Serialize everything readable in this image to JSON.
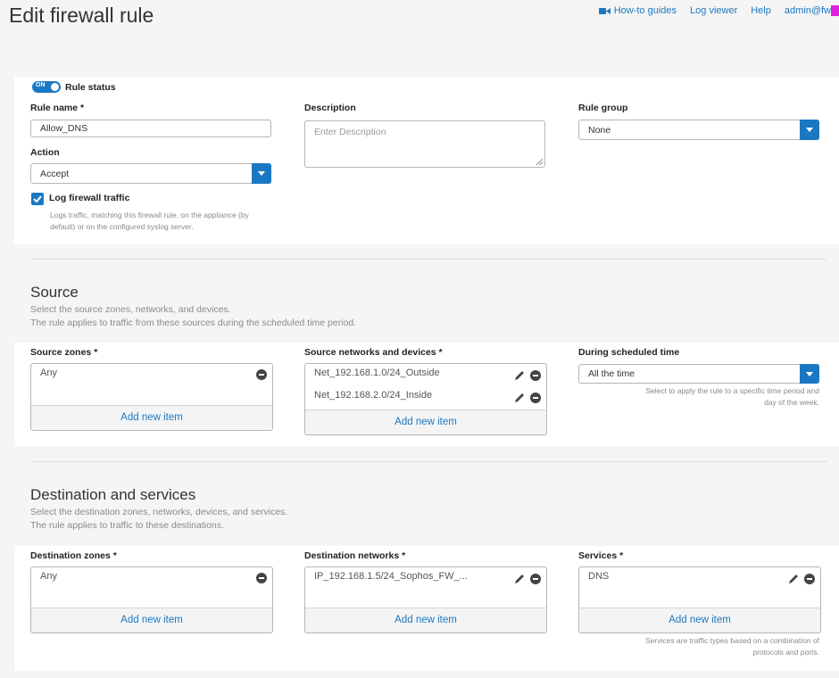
{
  "header": {
    "title": "Edit firewall rule",
    "nav": {
      "howto": "How-to guides",
      "logviewer": "Log viewer",
      "help": "Help",
      "admin": "admin@fw"
    }
  },
  "rule": {
    "status_toggle": "ON",
    "status_label": "Rule status",
    "name_label": "Rule name *",
    "name_value": "Allow_DNS",
    "description_label": "Description",
    "description_placeholder": "Enter Description",
    "group_label": "Rule group",
    "group_value": "None",
    "action_label": "Action",
    "action_value": "Accept",
    "log_label": "Log firewall traffic",
    "log_help_1": "Logs traffic, matching this firewall rule, on the appliance (by",
    "log_help_2": "default) or on the configured syslog server."
  },
  "source": {
    "title": "Source",
    "desc_1": "Select the source zones, networks, and devices.",
    "desc_2": "The rule applies to traffic from these sources during the scheduled time period.",
    "zones_label": "Source zones *",
    "zones": [
      "Any"
    ],
    "networks_label": "Source networks and devices *",
    "networks": [
      "Net_192.168.1.0/24_Outside",
      "Net_192.168.2.0/24_Inside"
    ],
    "schedule_label": "During scheduled time",
    "schedule_value": "All the time",
    "schedule_help_1": "Select to apply the rule to a specific time period and",
    "schedule_help_2": "day of the week.",
    "add_item": "Add new item"
  },
  "destination": {
    "title": "Destination and services",
    "desc_1": "Select the destination zones, networks, devices, and services.",
    "desc_2": "The rule applies to traffic to these destinations.",
    "zones_label": "Destination zones *",
    "zones": [
      "Any"
    ],
    "networks_label": "Destination networks *",
    "networks": [
      "IP_192.168.1.5/24_Sophos_FW_..."
    ],
    "services_label": "Services *",
    "services": [
      "DNS"
    ],
    "services_help_1": "Services are traffic types based on a combination of",
    "services_help_2": "protocols and ports.",
    "add_item": "Add new item"
  },
  "colors": {
    "accent": "#1a78c2",
    "background": "#f5f5f5",
    "panel": "#ffffff"
  }
}
